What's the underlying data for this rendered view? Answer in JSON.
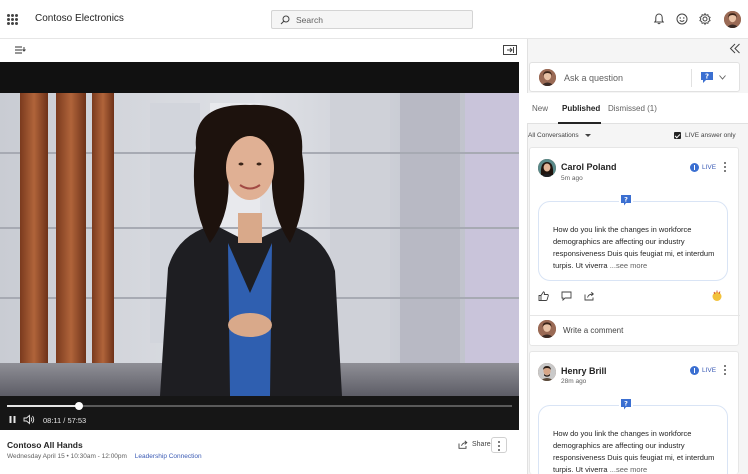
{
  "app": {
    "title": "Contoso Electronics"
  },
  "search": {
    "placeholder": "Search"
  },
  "colors": {
    "accent": "#3b6fd1",
    "link": "#3b5bb5",
    "panel_bg": "#f5f5f5",
    "video_bg": "#111111"
  },
  "top_icons": [
    "bell-icon",
    "smiley-icon",
    "gear-icon"
  ],
  "video": {
    "time": "08:11 / 57:53",
    "progress": 0.143
  },
  "event": {
    "title": "Contoso All Hands",
    "schedule": "Wednesday April 15  •  10:30am - 12:00pm",
    "link": "Leadership Connection",
    "share_label": "Share"
  },
  "qa": {
    "ask_placeholder": "Ask a question",
    "tabs": [
      {
        "label": "New"
      },
      {
        "label": "Published"
      },
      {
        "label": "Dismissed (1)"
      }
    ],
    "active_tab": "Published",
    "filter_label": "All Conversations",
    "live_only_label": "LIVE answer only",
    "live_only_checked": true,
    "questions": [
      {
        "author": "Carol Poland",
        "time": "5m ago",
        "badge": "LIVE",
        "text": "How do you link the changes in workforce demographics are affecting our industry responsiveness Duis quis feugiat mi, et interdum turpis. Ut viverra ",
        "see_more": "...see more",
        "comment_placeholder": "Write a comment"
      },
      {
        "author": "Henry Brill",
        "time": "28m ago",
        "badge": "LIVE",
        "text": "How do you link the changes in workforce demographics are affecting our industry responsiveness Duis quis feugiat mi, et interdum turpis. Ut viverra ",
        "see_more": "...see more"
      }
    ]
  }
}
